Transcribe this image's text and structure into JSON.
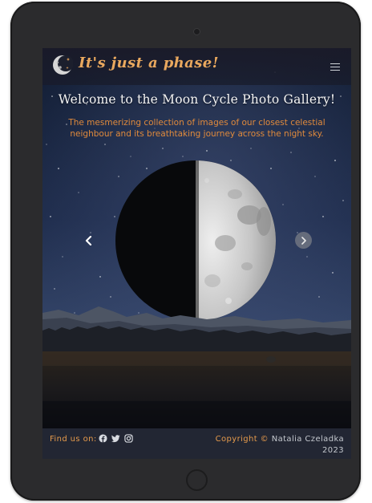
{
  "navbar": {
    "brand_title": "It's just a phase!",
    "logo_icon": "crescent-moon-icon",
    "menu_icon": "hamburger-menu-icon"
  },
  "hero": {
    "title": "Welcome to the Moon Cycle Photo Gallery!",
    "subtitle": "The mesmerizing collection of images of our closest celestial neighbour and its breathtaking journey across the night sky."
  },
  "carousel": {
    "prev_icon": "chevron-left-icon",
    "next_icon": "chevron-right-icon"
  },
  "footer": {
    "follow_label": "Find us on:",
    "social_icons": [
      "facebook-icon",
      "twitter-icon",
      "instagram-icon"
    ],
    "copyright_label": "Copyright ©",
    "copyright_name": "Natalia Czeladka",
    "copyright_year": "2023"
  },
  "colors": {
    "accent": "#e9a85e",
    "subtitle": "#e08a3c",
    "footer_bg": "#222633",
    "frame": "#2b2b2d"
  }
}
